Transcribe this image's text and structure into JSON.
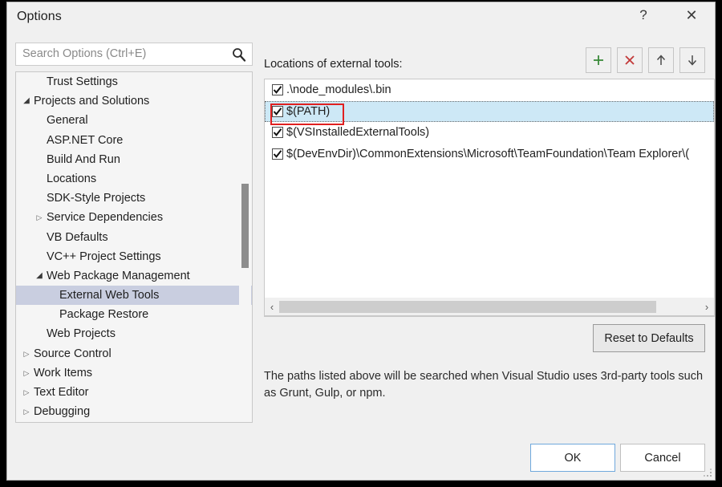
{
  "window": {
    "title": "Options",
    "help_label": "?",
    "close_label": "✕"
  },
  "search": {
    "placeholder": "Search Options (Ctrl+E)",
    "value": "",
    "icon": "search-icon"
  },
  "tree": {
    "items": [
      {
        "label": "Trust Settings",
        "indent": 2,
        "twisty": "none",
        "selected": false
      },
      {
        "label": "Projects and Solutions",
        "indent": 1,
        "twisty": "expanded",
        "selected": false
      },
      {
        "label": "General",
        "indent": 2,
        "twisty": "none",
        "selected": false
      },
      {
        "label": "ASP.NET Core",
        "indent": 2,
        "twisty": "none",
        "selected": false
      },
      {
        "label": "Build And Run",
        "indent": 2,
        "twisty": "none",
        "selected": false
      },
      {
        "label": "Locations",
        "indent": 2,
        "twisty": "none",
        "selected": false
      },
      {
        "label": "SDK-Style Projects",
        "indent": 2,
        "twisty": "none",
        "selected": false
      },
      {
        "label": "Service Dependencies",
        "indent": 2,
        "twisty": "collapsed",
        "selected": false
      },
      {
        "label": "VB Defaults",
        "indent": 2,
        "twisty": "none",
        "selected": false
      },
      {
        "label": "VC++ Project Settings",
        "indent": 2,
        "twisty": "none",
        "selected": false
      },
      {
        "label": "Web Package Management",
        "indent": 2,
        "twisty": "expanded",
        "selected": false
      },
      {
        "label": "External Web Tools",
        "indent": 3,
        "twisty": "none",
        "selected": true
      },
      {
        "label": "Package Restore",
        "indent": 3,
        "twisty": "none",
        "selected": false
      },
      {
        "label": "Web Projects",
        "indent": 2,
        "twisty": "none",
        "selected": false
      },
      {
        "label": "Source Control",
        "indent": 1,
        "twisty": "collapsed",
        "selected": false
      },
      {
        "label": "Work Items",
        "indent": 1,
        "twisty": "collapsed",
        "selected": false
      },
      {
        "label": "Text Editor",
        "indent": 1,
        "twisty": "collapsed",
        "selected": false
      },
      {
        "label": "Debugging",
        "indent": 1,
        "twisty": "collapsed",
        "selected": false
      }
    ]
  },
  "main": {
    "list_label": "Locations of external tools:",
    "toolbar": [
      {
        "name": "add-path-button",
        "icon": "plus-icon",
        "color": "#3a8a3a"
      },
      {
        "name": "delete-path-button",
        "icon": "close-x-icon",
        "color": "#c33a3a"
      },
      {
        "name": "move-up-button",
        "icon": "arrow-up-icon",
        "color": "#4a4a4a"
      },
      {
        "name": "move-down-button",
        "icon": "arrow-down-icon",
        "color": "#4a4a4a"
      }
    ],
    "paths": [
      {
        "label": ".\\node_modules\\.bin",
        "checked": true,
        "selected": false
      },
      {
        "label": "$(PATH)",
        "checked": true,
        "selected": true
      },
      {
        "label": "$(VSInstalledExternalTools)",
        "checked": true,
        "selected": false
      },
      {
        "label": "$(DevEnvDir)\\CommonExtensions\\Microsoft\\TeamFoundation\\Team Explorer\\(",
        "checked": true,
        "selected": false
      }
    ],
    "reset_label": "Reset to Defaults",
    "description": "The paths listed above will be searched when Visual Studio uses 3rd-party tools such as Grunt, Gulp, or npm.",
    "scroll_left_label": "‹",
    "scroll_right_label": "›"
  },
  "footer": {
    "ok_label": "OK",
    "cancel_label": "Cancel"
  },
  "colors": {
    "dialog_bg": "#f0f0f0",
    "selection_tree": "#c9cee0",
    "selection_list": "#cde8f6",
    "annotation": "#e02020",
    "accent_focus": "#6fa8dc"
  }
}
